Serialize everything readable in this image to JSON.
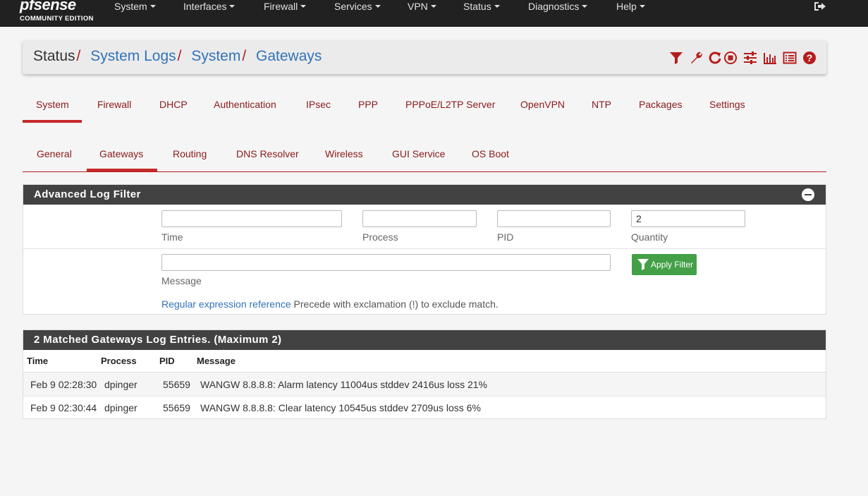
{
  "brand": {
    "logo_main": "pfsense",
    "logo_sub": "COMMUNITY EDITION"
  },
  "nav": {
    "items": [
      "System",
      "Interfaces",
      "Firewall",
      "Services",
      "VPN",
      "Status",
      "Diagnostics",
      "Help"
    ]
  },
  "breadcrumb": {
    "items": [
      "Status",
      "System Logs",
      "System",
      "Gateways"
    ]
  },
  "icons": [
    "filter-icon",
    "wrench-icon",
    "refresh-icon",
    "stop-icon",
    "sliders-icon",
    "chart-icon",
    "list-icon",
    "help-icon"
  ],
  "colors": {
    "accent": "#b71c1c",
    "link": "#3273b9",
    "navbar": "#212121",
    "panel_header": "#424242",
    "apply_button": "#43a047"
  },
  "tabs_primary": {
    "items": [
      "System",
      "Firewall",
      "DHCP",
      "Authentication",
      "IPsec",
      "PPP",
      "PPPoE/L2TP Server",
      "OpenVPN",
      "NTP",
      "Packages",
      "Settings"
    ],
    "active": "System"
  },
  "tabs_secondary": {
    "items": [
      "General",
      "Gateways",
      "Routing",
      "DNS Resolver",
      "Wireless",
      "GUI Service",
      "OS Boot"
    ],
    "active": "Gateways"
  },
  "filter": {
    "title": "Advanced Log Filter",
    "time_label": "Time",
    "time_value": "",
    "process_label": "Process",
    "process_value": "",
    "pid_label": "PID",
    "pid_value": "",
    "quantity_label": "Quantity",
    "quantity_value": "2",
    "message_label": "Message",
    "message_value": "",
    "apply_label": "Apply Filter",
    "regex_link": "Regular expression reference",
    "regex_hint": "Precede with exclamation (!) to exclude match."
  },
  "log": {
    "title": "2 Matched Gateways Log Entries. (Maximum 2)",
    "columns": [
      "Time",
      "Process",
      "PID",
      "Message"
    ],
    "rows": [
      {
        "time": "Feb 9 02:28:30",
        "process": "dpinger",
        "pid": "55659",
        "message": "WANGW 8.8.8.8: Alarm latency 11004us stddev 2416us loss 21%"
      },
      {
        "time": "Feb 9 02:30:44",
        "process": "dpinger",
        "pid": "55659",
        "message": "WANGW 8.8.8.8: Clear latency 10545us stddev 2709us loss 6%"
      }
    ]
  }
}
